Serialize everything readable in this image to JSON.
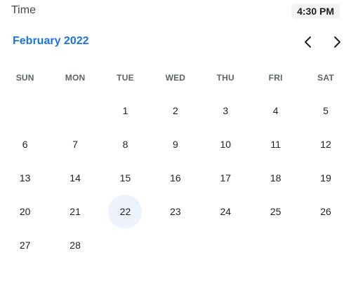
{
  "time_row": {
    "label": "Time",
    "value": "4:30 PM"
  },
  "calendar": {
    "month_title": "February 2022",
    "prev_icon": "chevron-left-icon",
    "next_icon": "chevron-right-icon",
    "weekdays": [
      "SUN",
      "MON",
      "TUE",
      "WED",
      "THU",
      "FRI",
      "SAT"
    ],
    "weeks": [
      [
        "",
        "",
        "1",
        "2",
        "3",
        "4",
        "5"
      ],
      [
        "6",
        "7",
        "8",
        "9",
        "10",
        "11",
        "12"
      ],
      [
        "13",
        "14",
        "15",
        "16",
        "17",
        "18",
        "19"
      ],
      [
        "20",
        "21",
        "22",
        "23",
        "24",
        "25",
        "26"
      ],
      [
        "27",
        "28",
        "",
        "",
        "",
        "",
        ""
      ]
    ],
    "highlighted_day": "22",
    "accent_color": "#1a73e8",
    "highlight_color": "#eef2fb"
  }
}
